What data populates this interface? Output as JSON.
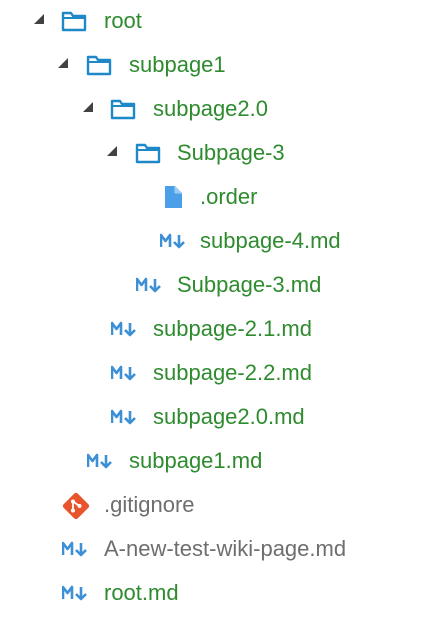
{
  "colors": {
    "modified_text": "#2e8b2e",
    "untracked_text": "#6e6e6e",
    "folder_icon": "#1e88c8",
    "markdown_icon": "#3d8fd6",
    "file_icon": "#4a9fe8",
    "git_icon": "#e8542c",
    "twistie": "#424242"
  },
  "tree": {
    "items": [
      {
        "label": "root",
        "kind": "folder",
        "icon": "folder-icon",
        "expanded": true,
        "status": "modified"
      },
      {
        "label": "subpage1",
        "kind": "folder",
        "icon": "folder-icon",
        "expanded": true,
        "status": "modified"
      },
      {
        "label": "subpage2.0",
        "kind": "folder",
        "icon": "folder-icon",
        "expanded": true,
        "status": "modified"
      },
      {
        "label": "Subpage-3",
        "kind": "folder",
        "icon": "folder-icon",
        "expanded": true,
        "status": "modified"
      },
      {
        "label": ".order",
        "kind": "file",
        "icon": "file-icon",
        "status": "modified"
      },
      {
        "label": "subpage-4.md",
        "kind": "markdown",
        "icon": "markdown-icon",
        "status": "modified"
      },
      {
        "label": "Subpage-3.md",
        "kind": "markdown",
        "icon": "markdown-icon",
        "status": "modified"
      },
      {
        "label": "subpage-2.1.md",
        "kind": "markdown",
        "icon": "markdown-icon",
        "status": "modified"
      },
      {
        "label": "subpage-2.2.md",
        "kind": "markdown",
        "icon": "markdown-icon",
        "status": "modified"
      },
      {
        "label": "subpage2.0.md",
        "kind": "markdown",
        "icon": "markdown-icon",
        "status": "modified"
      },
      {
        "label": "subpage1.md",
        "kind": "markdown",
        "icon": "markdown-icon",
        "status": "modified"
      },
      {
        "label": ".gitignore",
        "kind": "git",
        "icon": "git-icon",
        "status": "plain"
      },
      {
        "label": "A-new-test-wiki-page.md",
        "kind": "markdown",
        "icon": "markdown-icon",
        "status": "plain"
      },
      {
        "label": "root.md",
        "kind": "markdown",
        "icon": "markdown-icon",
        "status": "modified"
      }
    ]
  }
}
